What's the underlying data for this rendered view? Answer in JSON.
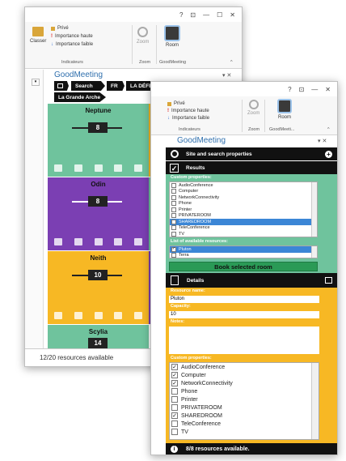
{
  "back_window": {
    "titlebar": {
      "help": "?",
      "restore": "⊡",
      "minimize": "—",
      "maximize": "☐",
      "close": "✕"
    },
    "ribbon": {
      "classer_label": "Classer",
      "prive_label": "Privé",
      "high_label": "Importance haute",
      "low_label": "Importance faible",
      "indicateurs_label": "Indicateurs",
      "zoom_label": "Zoom",
      "zoom_group": "Zoom",
      "room_label": "Room",
      "gm_group": "GoodMeeting"
    },
    "pane_title": "GoodMeeting",
    "crumbs": [
      "Search",
      "FR",
      "LA DÉFENSE",
      "La Grande Arche"
    ],
    "rooms": [
      {
        "name": "Neptune",
        "capacity": "8",
        "color": "#6fc39d"
      },
      {
        "name": "Odin",
        "capacity": "8",
        "color": "#7b3fb3"
      },
      {
        "name": "Neith",
        "capacity": "10",
        "color": "#f7b824"
      },
      {
        "name": "Scylia",
        "capacity": "14",
        "color": "#6fc39d"
      }
    ],
    "status": "12/20 resources available"
  },
  "front_window": {
    "titlebar": {
      "help": "?",
      "restore": "⊡",
      "minimize": "—",
      "close": "✕"
    },
    "ribbon": {
      "prive_label": "Privé",
      "high_label": "Importance haute",
      "low_label": "Importance faible",
      "indicateurs_label": "Indicateurs",
      "zoom_label": "Zoom",
      "zoom_group": "Zoom",
      "room_label": "Room",
      "gm_group": "GoodMeeti..."
    },
    "pane_title": "GoodMeeting",
    "site_section": "Site and search properties",
    "results_section": "Results",
    "custom_props_label": "Custom properties:",
    "search_props": [
      {
        "name": "AudioConference",
        "checked": false,
        "selected": false
      },
      {
        "name": "Computer",
        "checked": false,
        "selected": false
      },
      {
        "name": "NetworkConnectivity",
        "checked": false,
        "selected": false
      },
      {
        "name": "Phone",
        "checked": false,
        "selected": false
      },
      {
        "name": "Printer",
        "checked": false,
        "selected": false
      },
      {
        "name": "PRIVATEROOM",
        "checked": false,
        "selected": false
      },
      {
        "name": "SHAREDROOM",
        "checked": false,
        "selected": true
      },
      {
        "name": "TeleConference",
        "checked": false,
        "selected": false
      },
      {
        "name": "TV",
        "checked": false,
        "selected": false
      }
    ],
    "available_label": "List of available resources:",
    "available": [
      {
        "name": "Pluton",
        "checked": true,
        "selected": true
      },
      {
        "name": "Terra",
        "checked": false,
        "selected": false
      }
    ],
    "book_label": "Book selected room",
    "details_section": "Details",
    "resource_name_label": "Resource name:",
    "resource_name": "Pluton",
    "capacity_label": "Capacity:",
    "capacity_value": "10",
    "notes_label": "Notes:",
    "detail_props_label": "Custom properties:",
    "detail_props": [
      {
        "name": "AudioConference",
        "checked": true
      },
      {
        "name": "Computer",
        "checked": true
      },
      {
        "name": "NetworkConnectivity",
        "checked": true
      },
      {
        "name": "Phone",
        "checked": false
      },
      {
        "name": "Printer",
        "checked": false
      },
      {
        "name": "PRIVATEROOM",
        "checked": false
      },
      {
        "name": "SHAREDROOM",
        "checked": true
      },
      {
        "name": "TeleConference",
        "checked": false
      },
      {
        "name": "TV",
        "checked": false
      }
    ],
    "status": "8/8 resources available."
  }
}
